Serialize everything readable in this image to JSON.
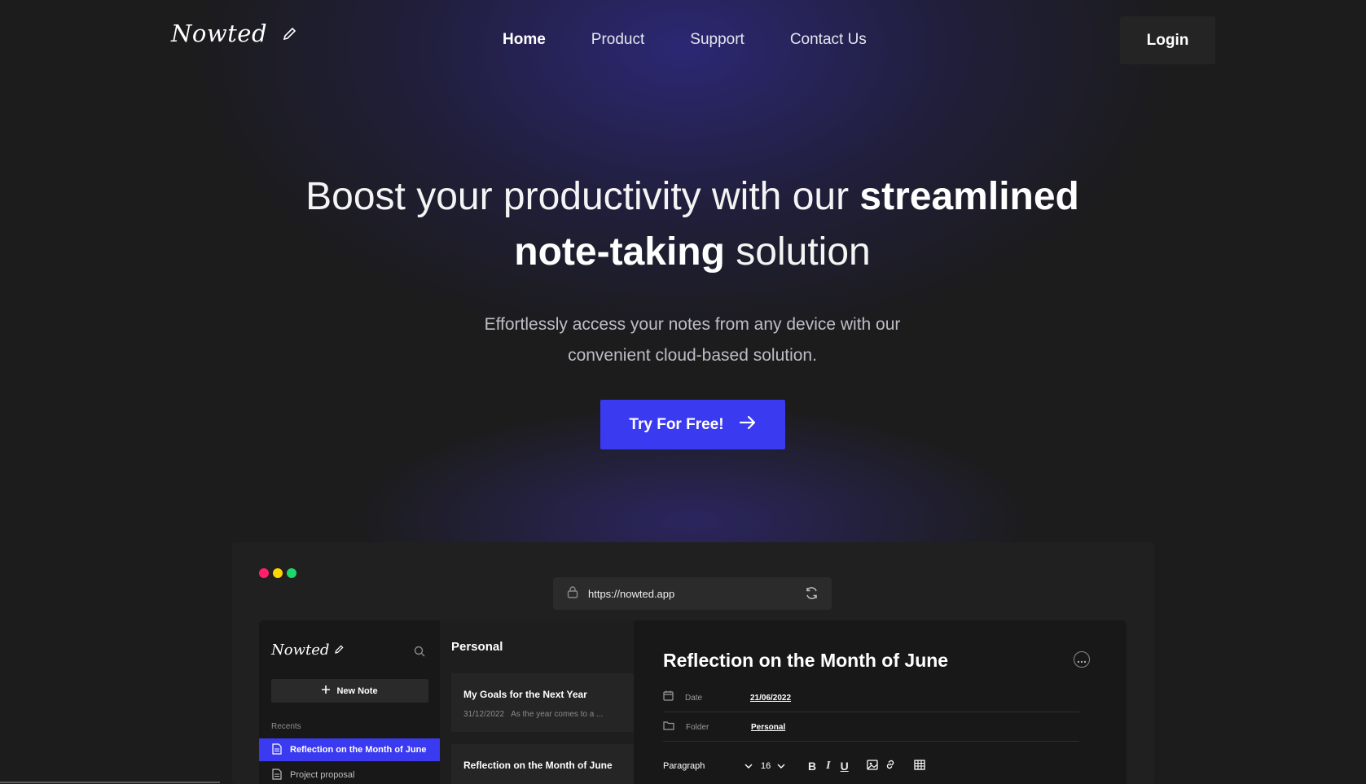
{
  "nav": {
    "logo": "Nowted",
    "links": [
      "Home",
      "Product",
      "Support",
      "Contact Us"
    ],
    "login_label": "Login"
  },
  "hero": {
    "headline_part1": "Boost your productivity with our ",
    "headline_bold1": "streamlined",
    "headline_bold2": "note-taking",
    "headline_part2": " solution",
    "subtitle_line1": "Effortlessly access your notes from any device with our",
    "subtitle_line2": "convenient cloud-based solution.",
    "cta_label": "Try For Free!"
  },
  "preview": {
    "window_dots": [
      "#ff1f6b",
      "#ffd400",
      "#1fd66b"
    ],
    "url": "https://nowted.app",
    "sidebar": {
      "logo": "Nowted",
      "new_note_label": "New Note",
      "recents_label": "Recents",
      "recents": [
        "Reflection on the Month of June",
        "Project proposal"
      ]
    },
    "notes_list": {
      "folder": "Personal",
      "notes": [
        {
          "title": "My Goals for the Next Year",
          "date": "31/12/2022",
          "snippet": "As the year comes to a ..."
        },
        {
          "title": "Reflection on the Month of June"
        }
      ]
    },
    "editor": {
      "title": "Reflection on the Month of June",
      "date_label": "Date",
      "date_value": "21/06/2022",
      "folder_label": "Folder",
      "folder_value": "Personal",
      "paragraph_label": "Paragraph",
      "font_size": "16"
    }
  },
  "colors": {
    "accent": "#3a3af0",
    "background": "#1c1c1c"
  }
}
